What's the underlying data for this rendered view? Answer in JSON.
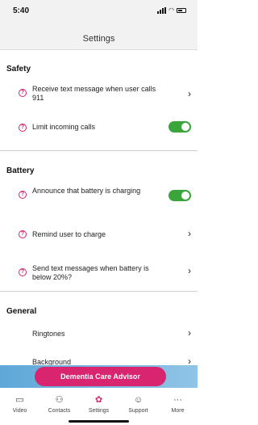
{
  "status": {
    "time": "5:40"
  },
  "nav": {
    "title": "Settings"
  },
  "sections": {
    "safety": {
      "title": "Safety",
      "items": [
        {
          "label": "Receive text message when user calls 911",
          "control": "chevron"
        },
        {
          "label": "Limit incoming calls",
          "control": "toggle",
          "on": true
        }
      ]
    },
    "battery": {
      "title": "Battery",
      "items": [
        {
          "label": "Announce that battery is charging",
          "control": "toggle",
          "on": true
        },
        {
          "label": "Remind user to charge",
          "control": "chevron"
        },
        {
          "label": "Send text messages when battery is below 20%?",
          "control": "chevron"
        }
      ]
    },
    "general": {
      "title": "General",
      "items": [
        {
          "label": "Ringtones",
          "control": "chevron"
        },
        {
          "label": "Background",
          "control": "chevron"
        }
      ]
    }
  },
  "banner": {
    "button_label": "Dementia Care Advisor"
  },
  "tabs": [
    {
      "label": "Video",
      "icon": "video-icon"
    },
    {
      "label": "Contacts",
      "icon": "contacts-icon"
    },
    {
      "label": "Settings",
      "icon": "settings-gear-icon",
      "active": true
    },
    {
      "label": "Support",
      "icon": "support-agent-icon"
    },
    {
      "label": "More",
      "icon": "more-dots-icon"
    }
  ],
  "colors": {
    "accent": "#d9256f",
    "toggle_on": "#3aa53a",
    "banner": "#6fb2de"
  },
  "icons": {
    "chevron": "chevron-right-icon",
    "help": "help-circle-icon"
  }
}
